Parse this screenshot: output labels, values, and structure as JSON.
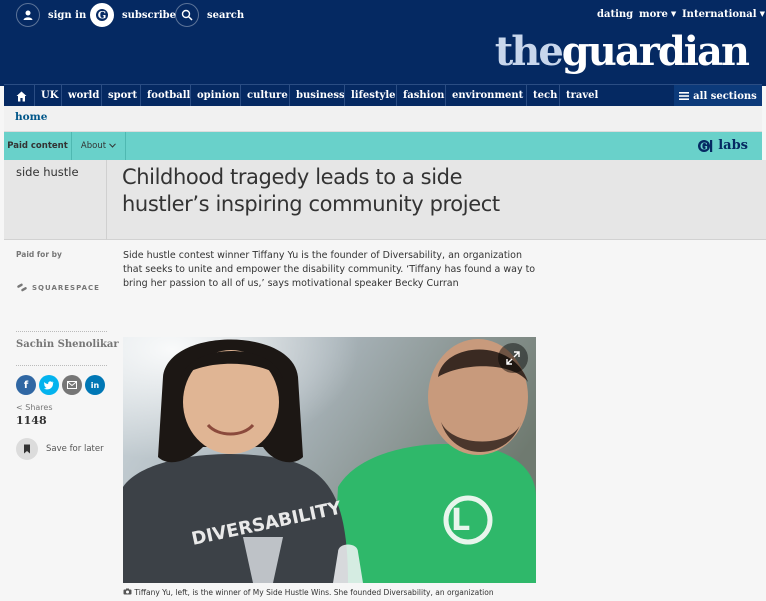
{
  "header": {
    "sign_in": "sign in",
    "subscribe": "subscribe",
    "search": "search",
    "dating": "dating",
    "more": "more",
    "edition": "International",
    "logo_the": "the",
    "logo_guardian": "guardian"
  },
  "nav": {
    "items": [
      "UK",
      "world",
      "sport",
      "football",
      "opinion",
      "culture",
      "business",
      "lifestyle",
      "fashion",
      "environment",
      "tech",
      "travel"
    ],
    "all_sections": "all sections"
  },
  "breadcrumb": {
    "home": "home"
  },
  "paid_bar": {
    "paid_content": "Paid content",
    "about": "About",
    "labs_logo": "labs"
  },
  "article": {
    "section": "side hustle",
    "headline": "Childhood tragedy leads to a side hustler’s inspiring community project",
    "standfirst": "Side hustle contest winner Tiffany Yu is the founder of Diversability, an organization that seeks to unite and empower the disability community. ‘Tiffany has found a way to bring her passion to all of us,’ says motivational speaker Becky Curran",
    "paid_by_label": "Paid for by",
    "sponsor": "SQUARESPACE",
    "author": "Sachin Shenolikar",
    "shares_label": "Shares",
    "share_count": "1148",
    "save_for_later": "Save for later",
    "image_caption": "Tiffany Yu, left, is the winner of My Side Hustle Wins. She founded Diversability, an organization",
    "shirt_text_left": "DIVERSABILITY",
    "shirt_text_right": "L"
  },
  "colors": {
    "brand_navy": "#052962",
    "labs_teal": "#69d1ca",
    "facebook": "#3067a3",
    "twitter": "#03b3ee",
    "email": "#767676",
    "linkedin": "#0077b5"
  }
}
